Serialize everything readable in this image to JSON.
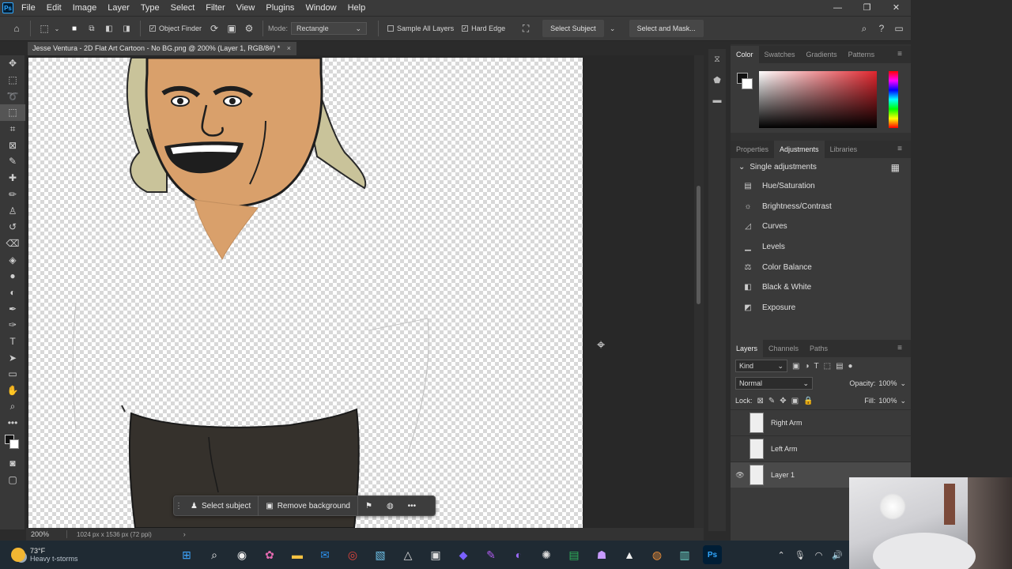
{
  "menu": {
    "app_icon": "Ps",
    "items": [
      "File",
      "Edit",
      "Image",
      "Layer",
      "Type",
      "Select",
      "Filter",
      "View",
      "Plugins",
      "Window",
      "Help"
    ]
  },
  "window_controls": {
    "minimize": "—",
    "restore": "❐",
    "close": "✕"
  },
  "options_bar": {
    "object_finder_label": "Object Finder",
    "mode_label": "Mode:",
    "mode_value": "Rectangle",
    "sample_all_layers_label": "Sample All Layers",
    "hard_edge_label": "Hard Edge",
    "select_subject_label": "Select Subject",
    "select_and_mask_label": "Select and Mask..."
  },
  "document_tab": {
    "title": "Jesse Ventura - 2D Flat Art Cartoon - No BG.png @ 200% (Layer 1, RGB/8#) *",
    "close": "×"
  },
  "status_bar": {
    "zoom": "200%",
    "doc_info": "1024 px x 1536 px (72 ppi)",
    "arrow": "›"
  },
  "context_bar": {
    "select_subject_label": "Select subject",
    "remove_background_label": "Remove background",
    "more_label": "•••"
  },
  "color_panel": {
    "tabs": [
      "Color",
      "Swatches",
      "Gradients",
      "Patterns"
    ],
    "active_tab": "Color",
    "foreground": "#111111",
    "background": "#ffffff"
  },
  "adjustments_panel": {
    "tabs": [
      "Properties",
      "Adjustments",
      "Libraries"
    ],
    "active_tab": "Adjustments",
    "section_title": "Single adjustments",
    "items": [
      {
        "label": "Hue/Saturation",
        "icon": "hue-saturation-icon"
      },
      {
        "label": "Brightness/Contrast",
        "icon": "brightness-icon"
      },
      {
        "label": "Curves",
        "icon": "curves-icon"
      },
      {
        "label": "Levels",
        "icon": "levels-icon"
      },
      {
        "label": "Color Balance",
        "icon": "color-balance-icon"
      },
      {
        "label": "Black & White",
        "icon": "black-white-icon"
      },
      {
        "label": "Exposure",
        "icon": "exposure-icon"
      }
    ]
  },
  "layers_panel": {
    "tabs": [
      "Layers",
      "Channels",
      "Paths"
    ],
    "active_tab": "Layers",
    "kind_label": "Kind",
    "blend_mode": "Normal",
    "opacity_label": "Opacity:",
    "opacity_value": "100%",
    "lock_label": "Lock:",
    "fill_label": "Fill:",
    "fill_value": "100%",
    "layers": [
      {
        "name": "Right Arm",
        "visible": false
      },
      {
        "name": "Left Arm",
        "visible": false
      },
      {
        "name": "Layer 1",
        "visible": true,
        "selected": true
      }
    ]
  },
  "taskbar": {
    "weather_temp": "73°F",
    "weather_desc": "Heavy t-storms"
  }
}
